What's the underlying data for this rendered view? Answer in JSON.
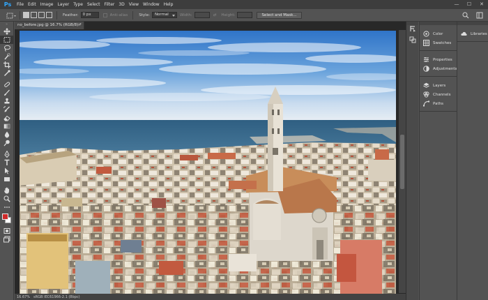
{
  "app": {
    "logo_text": "Ps",
    "accent": "#31a8ff"
  },
  "menu": {
    "items": [
      "File",
      "Edit",
      "Image",
      "Layer",
      "Type",
      "Select",
      "Filter",
      "3D",
      "View",
      "Window",
      "Help"
    ]
  },
  "window_controls": {
    "minimize": "—",
    "maximize": "☐",
    "close": "✕"
  },
  "options": {
    "feather_label": "Feather:",
    "feather_value": "0 px",
    "antialias_label": "Anti-alias",
    "style_label": "Style:",
    "style_value": "Normal",
    "width_label": "Width:",
    "height_label": "Height:",
    "select_mask_label": "Select and Mask..."
  },
  "document": {
    "tab_title": "no_before.jpg @ 16.7% (RGB/8) *",
    "tab_close": "×",
    "zoom": "16.67%",
    "status_info": "sRGB IEC61966-2.1 (8bpc)"
  },
  "tools": [
    "move",
    "marquee",
    "lasso",
    "quick-select",
    "crop",
    "eyedropper",
    "healing",
    "brush",
    "clone-stamp",
    "history-brush",
    "eraser",
    "gradient",
    "blur",
    "dodge",
    "pen",
    "type",
    "path-select",
    "rectangle",
    "hand",
    "zoom",
    "more"
  ],
  "colors": {
    "foreground": "#cf2a2a",
    "background": "#ffffff"
  },
  "panels": {
    "group1": [
      "Color",
      "Swatches"
    ],
    "group2": [
      "Properties",
      "Adjustments"
    ],
    "group3": [
      "Layers",
      "Channels",
      "Paths"
    ],
    "libraries": "Libraries"
  }
}
